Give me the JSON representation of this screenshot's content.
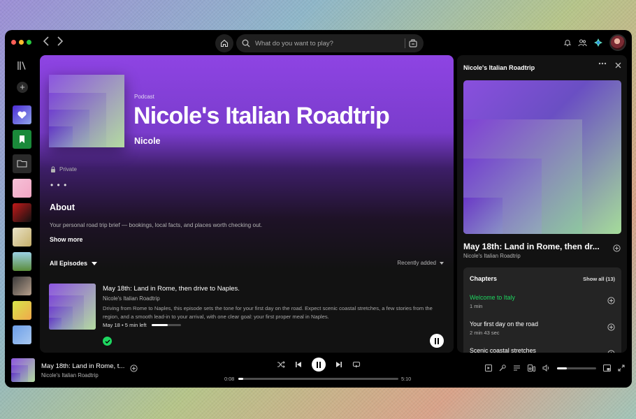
{
  "search": {
    "placeholder": "What do you want to play?"
  },
  "podcast": {
    "label": "Podcast",
    "title": "Nicole's Italian Roadtrip",
    "author": "Nicole",
    "visibility": "Private",
    "more": "• • •",
    "about_heading": "About",
    "about_text": "Your personal road trip brief — bookings, local facts, and places worth checking out.",
    "show_more": "Show more",
    "filter_label": "All Episodes",
    "sort_label": "Recently added"
  },
  "episode": {
    "title": "May 18th: Land in Rome, then drive to Naples.",
    "show": "Nicole's Italian Roadtrip",
    "description": "Driving from Rome to Naples, this episode sets the tone for your first day on the road. Expect scenic coastal stretches, a few stories from the region, and a smooth lead-in to your arrival, with one clear goal: your first proper meal in Naples.",
    "meta": "May 18 • 5 min left",
    "progress_fraction": 0.55
  },
  "right_panel": {
    "heading": "Nicole's Italian Roadtrip",
    "title": "May 18th: Land in Rome, then dr...",
    "show": "Nicole's Italian Roadtrip",
    "chapters_heading": "Chapters",
    "show_all": "Show all (13)",
    "chapters": [
      {
        "name": "Welcome to Italy",
        "duration": "1 min"
      },
      {
        "name": "Your first day on the road",
        "duration": "2 min 43 sec"
      },
      {
        "name": "Scenic coastal stretches",
        "duration": ""
      }
    ]
  },
  "player": {
    "title": "May 18th: Land in Rome, t...",
    "show": "Nicole's Italian Roadtrip",
    "elapsed": "0:08",
    "total": "5:10",
    "progress_fraction": 0.03,
    "volume_fraction": 0.25
  },
  "colors": {
    "accent": "#1ed760",
    "brand_purple": "#8e44e3",
    "brand_green": "#a7d49a"
  },
  "library_tiles": [
    {
      "name": "liked-songs-tile",
      "bg": "linear-gradient(135deg,#4b2bd6,#8fa6e8)"
    },
    {
      "name": "library-tile-green",
      "bg": "#1a8a3a"
    },
    {
      "name": "library-tile-folder",
      "bg": "#2a2a2a"
    },
    {
      "name": "library-tile-pink",
      "bg": "linear-gradient(135deg,#f6c1d8,#f2a6c4)"
    },
    {
      "name": "library-tile-red",
      "bg": "linear-gradient(135deg,#c31a1a,#111)"
    },
    {
      "name": "library-tile-yellow",
      "bg": "linear-gradient(135deg,#e9e2c8,#c6b06a)"
    },
    {
      "name": "library-tile-landscape",
      "bg": "linear-gradient(180deg,#9bd0e3,#5a8c3a)"
    },
    {
      "name": "library-tile-dark",
      "bg": "linear-gradient(135deg,#3a3a3a,#b7a08c)"
    },
    {
      "name": "library-tile-lime",
      "bg": "linear-gradient(135deg,#d6e64a,#f1a84b)"
    },
    {
      "name": "library-tile-blue",
      "bg": "linear-gradient(135deg,#6b9ee8,#a9c8f0)"
    },
    {
      "name": "library-tile-sunset",
      "bg": "linear-gradient(180deg,#b36ad6,#f0a7a0)"
    }
  ]
}
